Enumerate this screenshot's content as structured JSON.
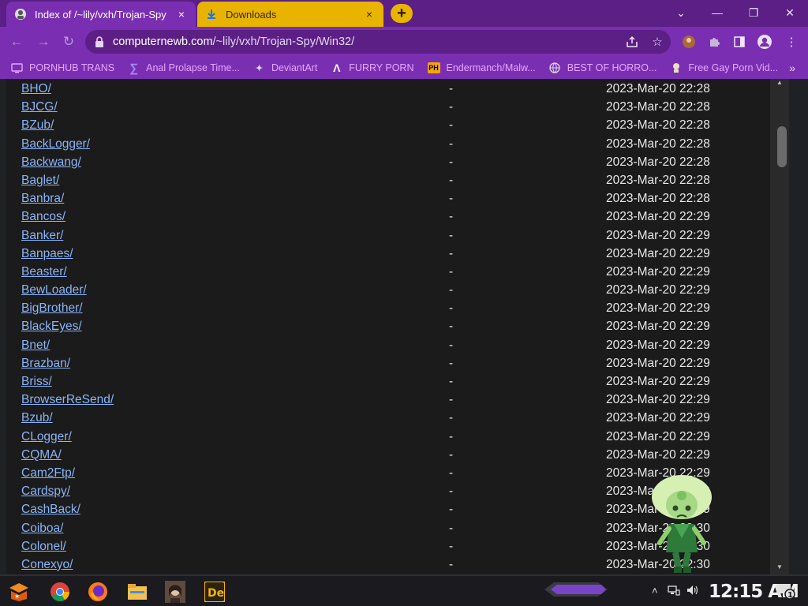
{
  "tabs": [
    {
      "title": "Index of /~lily/vxh/Trojan-Spy",
      "close": "×",
      "active": true
    },
    {
      "title": "Downloads",
      "close": "×",
      "active": false
    }
  ],
  "new_tab_label": "+",
  "window_controls": {
    "dropdown": "⌄",
    "minimize": "—",
    "restore": "❐",
    "close": "✕"
  },
  "nav": {
    "back": "←",
    "forward": "→",
    "reload": "↻"
  },
  "url": {
    "host": "computernewb.com",
    "path": "/~lily/vxh/Trojan-Spy/Win32/"
  },
  "bookmarks": [
    {
      "label": "PORNHUB TRANS",
      "icon": "tv-icon"
    },
    {
      "label": "Anal Prolapse Time...",
      "icon": "sigma-icon"
    },
    {
      "label": "DeviantArt",
      "icon": "deviantart-icon"
    },
    {
      "label": "FURRY PORN",
      "icon": "lambda-icon"
    },
    {
      "label": "Endermanch/Malw...",
      "icon": "ph-icon"
    },
    {
      "label": "BEST OF HORRO...",
      "icon": "globe-icon"
    },
    {
      "label": "Free Gay Porn Vid...",
      "icon": "logo-icon"
    }
  ],
  "bookmarks_more": "»",
  "listing": [
    {
      "name": "BHO/",
      "size": "-",
      "date": "2023-Mar-20 22:28"
    },
    {
      "name": "BJCG/",
      "size": "-",
      "date": "2023-Mar-20 22:28"
    },
    {
      "name": "BZub/",
      "size": "-",
      "date": "2023-Mar-20 22:28"
    },
    {
      "name": "BackLogger/",
      "size": "-",
      "date": "2023-Mar-20 22:28"
    },
    {
      "name": "Backwang/",
      "size": "-",
      "date": "2023-Mar-20 22:28"
    },
    {
      "name": "Baglet/",
      "size": "-",
      "date": "2023-Mar-20 22:28"
    },
    {
      "name": "Banbra/",
      "size": "-",
      "date": "2023-Mar-20 22:28"
    },
    {
      "name": "Bancos/",
      "size": "-",
      "date": "2023-Mar-20 22:29"
    },
    {
      "name": "Banker/",
      "size": "-",
      "date": "2023-Mar-20 22:29"
    },
    {
      "name": "Banpaes/",
      "size": "-",
      "date": "2023-Mar-20 22:29"
    },
    {
      "name": "Beaster/",
      "size": "-",
      "date": "2023-Mar-20 22:29"
    },
    {
      "name": "BewLoader/",
      "size": "-",
      "date": "2023-Mar-20 22:29"
    },
    {
      "name": "BigBrother/",
      "size": "-",
      "date": "2023-Mar-20 22:29"
    },
    {
      "name": "BlackEyes/",
      "size": "-",
      "date": "2023-Mar-20 22:29"
    },
    {
      "name": "Bnet/",
      "size": "-",
      "date": "2023-Mar-20 22:29"
    },
    {
      "name": "Brazban/",
      "size": "-",
      "date": "2023-Mar-20 22:29"
    },
    {
      "name": "Briss/",
      "size": "-",
      "date": "2023-Mar-20 22:29"
    },
    {
      "name": "BrowserReSend/",
      "size": "-",
      "date": "2023-Mar-20 22:29"
    },
    {
      "name": "Bzub/",
      "size": "-",
      "date": "2023-Mar-20 22:29"
    },
    {
      "name": "CLogger/",
      "size": "-",
      "date": "2023-Mar-20 22:29"
    },
    {
      "name": "CQMA/",
      "size": "-",
      "date": "2023-Mar-20 22:29"
    },
    {
      "name": "Cam2Ftp/",
      "size": "-",
      "date": "2023-Mar-20 22:29"
    },
    {
      "name": "Cardspy/",
      "size": "-",
      "date": "2023-Mar-20 22:29"
    },
    {
      "name": "CashBack/",
      "size": "-",
      "date": "2023-Mar-20 22:29"
    },
    {
      "name": "Coiboa/",
      "size": "-",
      "date": "2023-Mar-20 22:30"
    },
    {
      "name": "Colonel/",
      "size": "-",
      "date": "2023-Mar-20 22:30"
    },
    {
      "name": "Conexyo/",
      "size": "-",
      "date": "2023-Mar-20 22:30"
    }
  ],
  "taskbar": {
    "clock": "12:15 AM",
    "notification_count": "1",
    "apps": [
      "start-icon",
      "chrome-icon",
      "firefox-icon",
      "file-explorer-icon",
      "portrait-app-icon",
      "de-app-icon"
    ]
  },
  "colors": {
    "tab_strip": "#5b1f86",
    "toolbar": "#7a2fb2",
    "downloads_tab": "#e8b400",
    "link": "#8ab4f8",
    "bookmark_text": "#e8a6ff"
  }
}
